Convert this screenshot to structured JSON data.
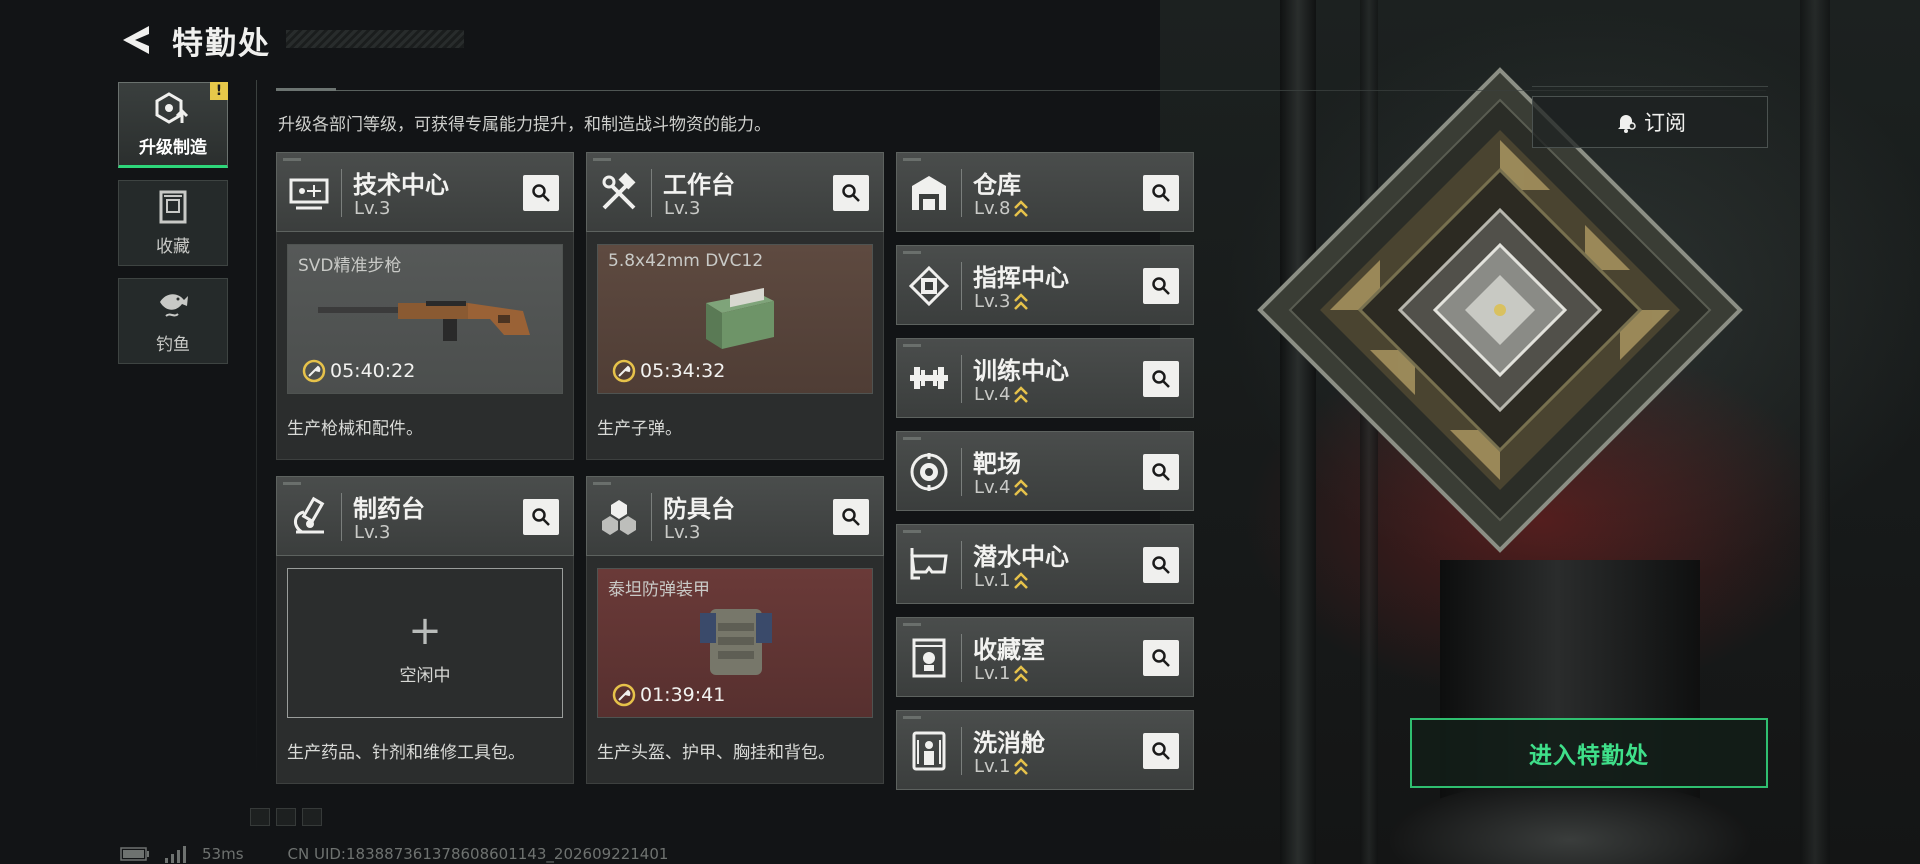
{
  "header": {
    "title": "特勤处",
    "description": "升级各部门等级，可获得专属能力提升，和制造战斗物资的能力。"
  },
  "sidebar": {
    "items": [
      {
        "label": "升级制造",
        "icon": "upgrade-craft-icon",
        "active": true,
        "badge": "!"
      },
      {
        "label": "收藏",
        "icon": "collection-icon",
        "active": false
      },
      {
        "label": "钓鱼",
        "icon": "fish-icon",
        "active": false
      }
    ]
  },
  "production_buildings": [
    {
      "name": "技术中心",
      "level": "Lv.3",
      "icon": "tech-center-icon",
      "slot": {
        "state": "producing",
        "item": "SVD精准步枪",
        "timer": "05:40:22",
        "item_icon": "rifle-icon"
      },
      "description": "生产枪械和配件。"
    },
    {
      "name": "工作台",
      "level": "Lv.3",
      "icon": "workbench-icon",
      "slot": {
        "state": "producing",
        "item": "5.8x42mm DVC12",
        "timer": "05:34:32",
        "item_icon": "ammo-box-icon"
      },
      "description": "生产子弹。"
    },
    {
      "name": "制药台",
      "level": "Lv.3",
      "icon": "pharmacy-icon",
      "slot": {
        "state": "idle",
        "plus": "+",
        "label": "空闲中"
      },
      "description": "生产药品、针剂和维修工具包。"
    },
    {
      "name": "防具台",
      "level": "Lv.3",
      "icon": "armor-bench-icon",
      "slot": {
        "state": "producing",
        "item": "泰坦防弹装甲",
        "timer": "01:39:41",
        "item_icon": "body-armor-icon"
      },
      "description": "生产头盔、护甲、胸挂和背包。"
    }
  ],
  "facilities": [
    {
      "name": "仓库",
      "level": "Lv.8",
      "icon": "warehouse-icon"
    },
    {
      "name": "指挥中心",
      "level": "Lv.3",
      "icon": "command-center-icon"
    },
    {
      "name": "训练中心",
      "level": "Lv.4",
      "icon": "training-center-icon"
    },
    {
      "name": "靶场",
      "level": "Lv.4",
      "icon": "shooting-range-icon"
    },
    {
      "name": "潜水中心",
      "level": "Lv.1",
      "icon": "diving-center-icon"
    },
    {
      "name": "收藏室",
      "level": "Lv.1",
      "icon": "collection-room-icon"
    },
    {
      "name": "洗消舱",
      "level": "Lv.1",
      "icon": "decontamination-icon"
    }
  ],
  "buttons": {
    "subscribe": "订阅",
    "enter": "进入特勤处"
  },
  "status": {
    "ping": "53ms",
    "uid": "CN UID:1838873613786086011​43_202609221401"
  },
  "colors": {
    "accent_green": "#2fbf70",
    "level_up_gold": "#e6c24a",
    "alert_yellow": "#e6c84a",
    "slot_brown": "#5e4a40",
    "slot_red": "#6a3a38"
  }
}
